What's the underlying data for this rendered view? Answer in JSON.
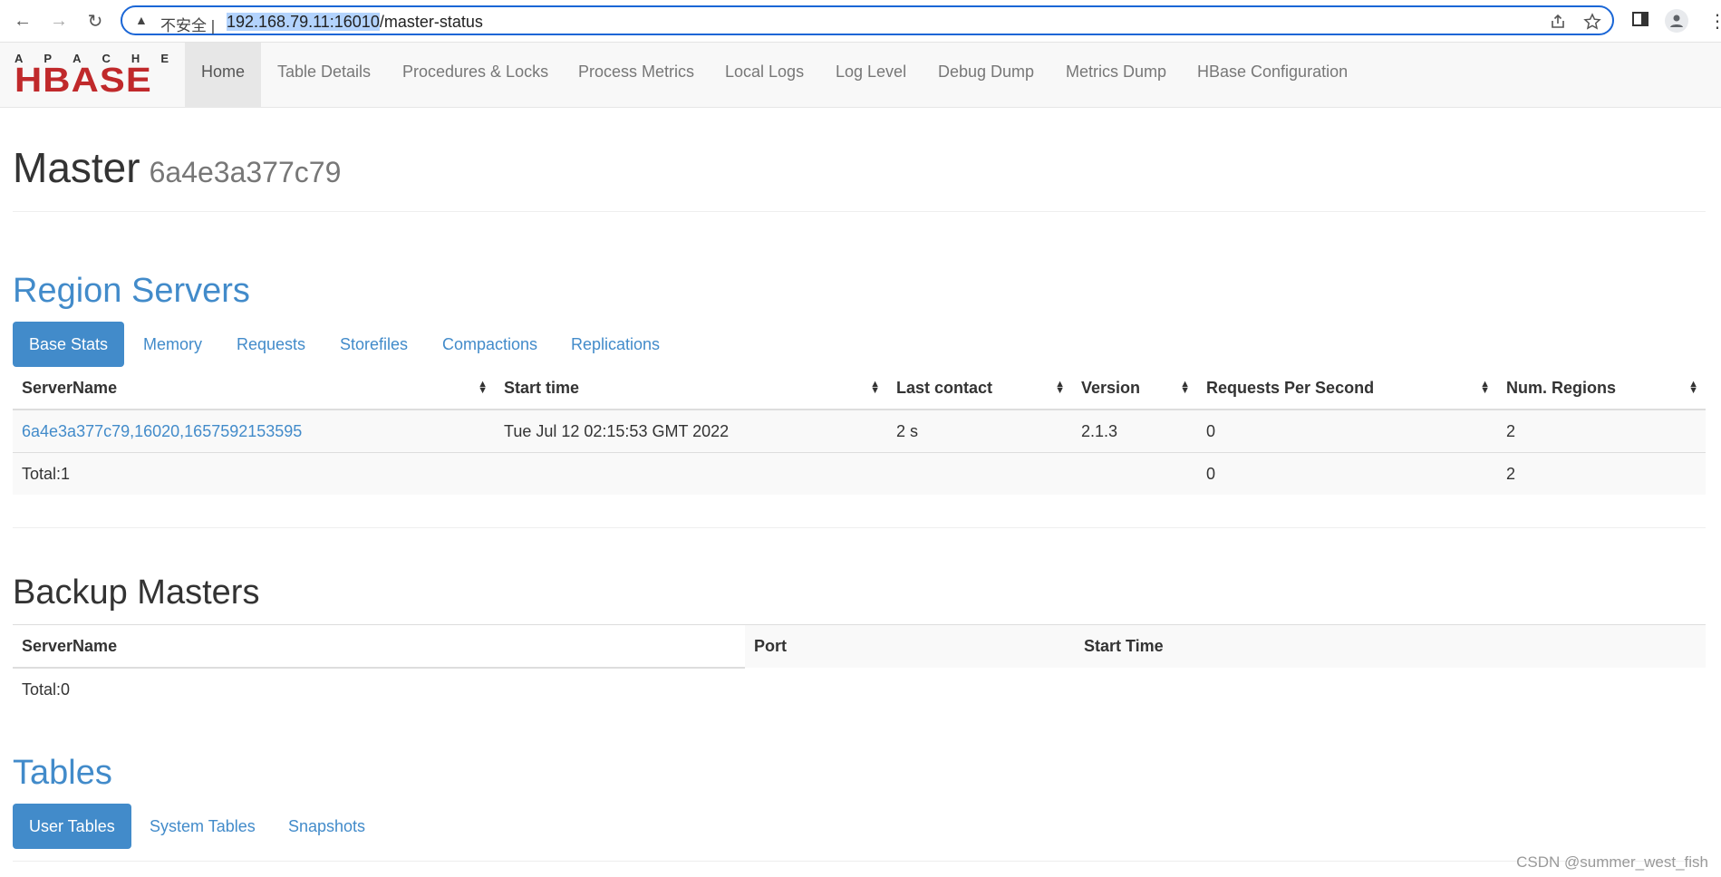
{
  "browser": {
    "back_icon": "←",
    "forward_icon": "→",
    "reload_icon": "↻",
    "warning_icon": "▲",
    "insecure_label": "不安全 |",
    "url_host": "192.168.79.11:16010",
    "url_path": "/master-status"
  },
  "navbar": {
    "logo_top": [
      "A",
      "P",
      "A",
      "C",
      "H",
      "E"
    ],
    "logo_main": "HBASE",
    "items": [
      "Home",
      "Table Details",
      "Procedures & Locks",
      "Process Metrics",
      "Local Logs",
      "Log Level",
      "Debug Dump",
      "Metrics Dump",
      "HBase Configuration"
    ]
  },
  "master": {
    "title": "Master",
    "host": "6a4e3a377c79"
  },
  "region_servers": {
    "title": "Region Servers",
    "tabs": [
      "Base Stats",
      "Memory",
      "Requests",
      "Storefiles",
      "Compactions",
      "Replications"
    ],
    "columns": [
      "ServerName",
      "Start time",
      "Last contact",
      "Version",
      "Requests Per Second",
      "Num. Regions"
    ],
    "rows": [
      [
        "6a4e3a377c79,16020,1657592153595",
        "Tue Jul 12 02:15:53 GMT 2022",
        "2 s",
        "2.1.3",
        "0",
        "2"
      ]
    ],
    "total": {
      "label": "Total:1",
      "rps": "0",
      "regions": "2"
    }
  },
  "backup_masters": {
    "title": "Backup Masters",
    "columns": [
      "ServerName",
      "Port",
      "Start Time"
    ],
    "total": "Total:0"
  },
  "tables": {
    "title": "Tables",
    "tabs": [
      "User Tables",
      "System Tables",
      "Snapshots"
    ]
  },
  "watermark": "CSDN @summer_west_fish"
}
